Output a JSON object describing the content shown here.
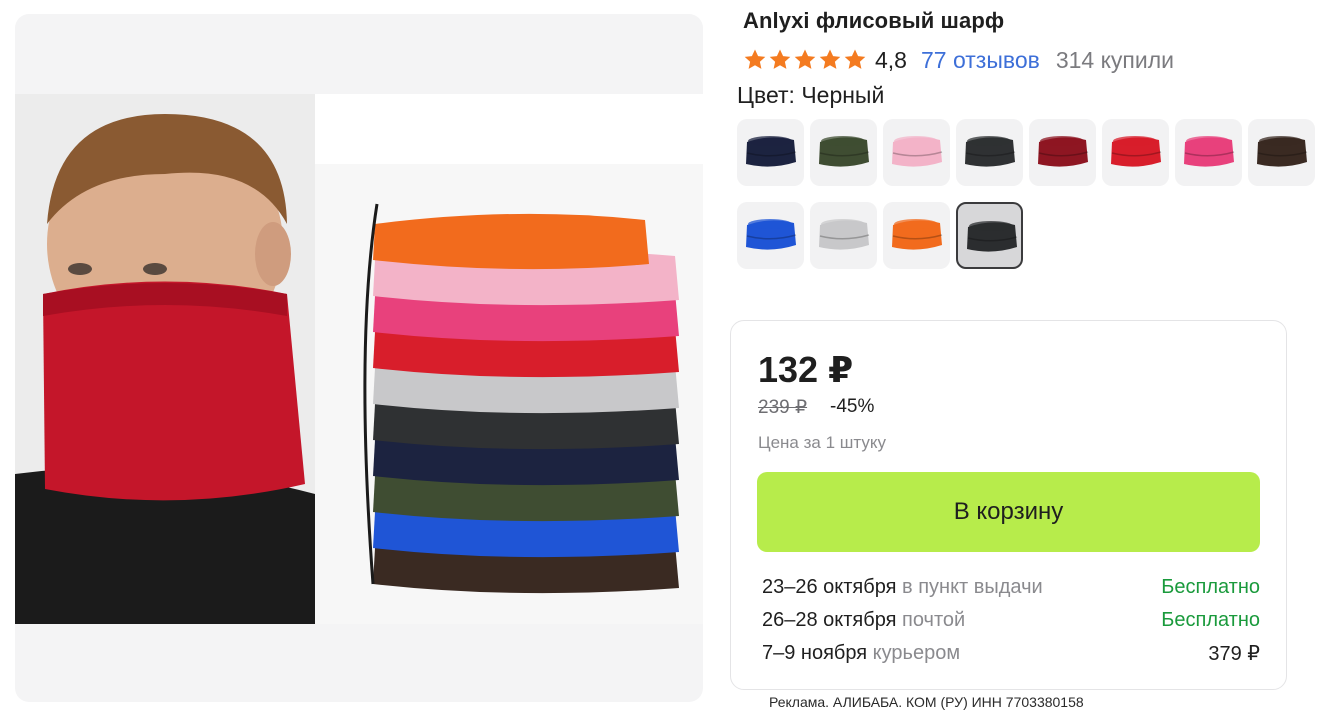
{
  "product": {
    "title": "Anlyxi флисовый шарф",
    "rating": "4,8",
    "reviews_label": "77 отзывов",
    "bought_label": "314 купили",
    "star_color": "#f47b20",
    "star_count": 5
  },
  "color_selector": {
    "label": "Цвет: Черный",
    "options": [
      {
        "color": "#1c2340",
        "selected": false
      },
      {
        "color": "#3f4d32",
        "selected": false
      },
      {
        "color": "#f3b3c8",
        "selected": false
      },
      {
        "color": "#2f3133",
        "selected": false
      },
      {
        "color": "#8e1622",
        "selected": false
      },
      {
        "color": "#d81e2b",
        "selected": false
      },
      {
        "color": "#e8417c",
        "selected": false
      },
      {
        "color": "#3a2a22",
        "selected": false
      },
      {
        "color": "#1f55d6",
        "selected": false
      },
      {
        "color": "#c8c8ca",
        "selected": false
      },
      {
        "color": "#f26b1d",
        "selected": false
      },
      {
        "color": "#2b2d2f",
        "selected": true
      }
    ]
  },
  "offer": {
    "price": "132 ₽",
    "old_price": "239 ₽",
    "discount": "-45%",
    "unit_price": "Цена за 1 штуку",
    "cart_button": "В корзину",
    "button_color": "#b7ec4b"
  },
  "delivery": [
    {
      "date": "23–26 октября",
      "method": "в пункт выдачи",
      "price": "Бесплатно",
      "free": true
    },
    {
      "date": "26–28 октября",
      "method": "почтой",
      "price": "Бесплатно",
      "free": true
    },
    {
      "date": "7–9 ноября",
      "method": "курьером",
      "price": "379 ₽",
      "free": false
    }
  ],
  "ad_note": "Реклама. АЛИБАБА. КОМ (РУ) ИНН 7703380158",
  "gallery": {
    "stack_colors": [
      "#f26b1d",
      "#f3b3c8",
      "#e8417c",
      "#d81e2b",
      "#c8c8ca",
      "#2f3133",
      "#1c2340",
      "#3f4d32",
      "#1f55d6",
      "#3a2a22"
    ],
    "model_scarf_color": "#c4162a"
  }
}
